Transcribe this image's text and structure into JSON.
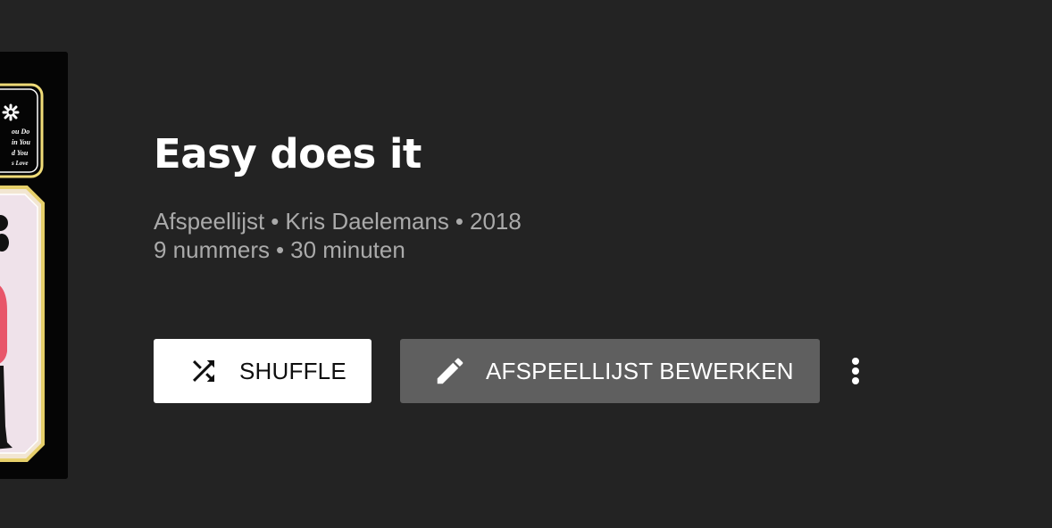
{
  "playlist": {
    "title": "Easy does it",
    "type_label": "Afspeellijst",
    "owner": "Kris Daelemans",
    "year": "2018",
    "track_count": "9 nummers",
    "duration": "30 minuten",
    "separator": "•"
  },
  "album_art": {
    "cover_text_lines": [
      "ou Do",
      "in You",
      "d You",
      "s Love"
    ]
  },
  "actions": {
    "shuffle_label": "SHUFFLE",
    "shuffle_icon": "shuffle-icon",
    "edit_label": "AFSPEELLIJST BEWERKEN",
    "edit_icon": "pencil-icon",
    "more_icon": "more-vert-icon"
  },
  "colors": {
    "background": "#232323",
    "title": "#ffffff",
    "meta_text": "#aaaaaa",
    "shuffle_button_bg": "#ffffff",
    "edit_button_bg": "#5f5f5f"
  }
}
